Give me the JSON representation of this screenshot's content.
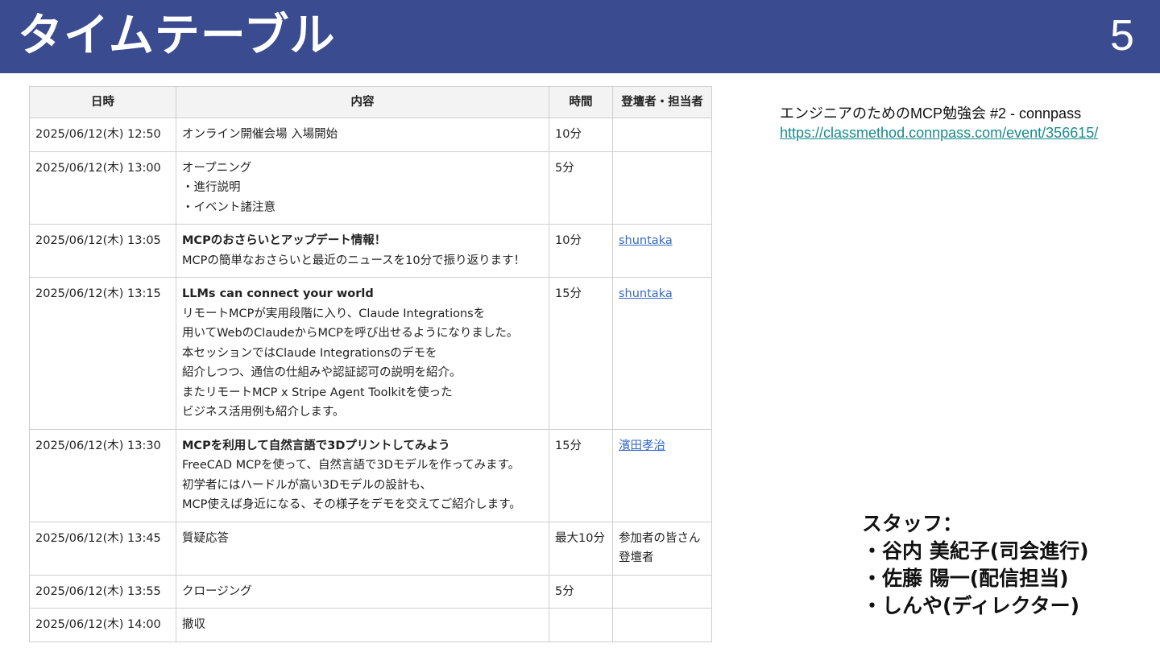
{
  "header": {
    "title": "タイムテーブル",
    "page_number": "5",
    "bg_color": "#3a4b90"
  },
  "table": {
    "headers": [
      "日時",
      "内容",
      "時間",
      "登壇者・担当者"
    ],
    "rows": [
      {
        "datetime": "2025/06/12(木) 12:50",
        "title": "",
        "lines": [
          "オンライン開催会場 入場開始"
        ],
        "duration": "10分",
        "person": ""
      },
      {
        "datetime": "2025/06/12(木) 13:00",
        "title": "",
        "lines": [
          "オープニング",
          "・進行説明",
          "・イベント諸注意"
        ],
        "duration": "5分",
        "person": ""
      },
      {
        "datetime": "2025/06/12(木) 13:05",
        "title": "MCPのおさらいとアップデート情報！",
        "lines": [
          "MCPの簡単なおさらいと最近のニュースを10分で振り返ります！"
        ],
        "duration": "10分",
        "person": "shuntaka"
      },
      {
        "datetime": "2025/06/12(木) 13:15",
        "title": "LLMs can connect your world",
        "lines": [
          "リモートMCPが実用段階に入り、Claude Integrationsを",
          "用いてWebのClaudeからMCPを呼び出せるようになりました。",
          "本セッションではClaude Integrationsのデモを",
          "紹介しつつ、通信の仕組みや認証認可の説明を紹介。",
          "またリモートMCP x Stripe Agent Toolkitを使った",
          "ビジネス活用例も紹介します。"
        ],
        "duration": "15分",
        "person": "shuntaka"
      },
      {
        "datetime": "2025/06/12(木) 13:30",
        "title": "MCPを利用して自然言語で3Dプリントしてみよう",
        "lines": [
          "FreeCAD MCPを使って、自然言語で3Dモデルを作ってみます。",
          "初学者にはハードルが高い3Dモデルの設計も、",
          "MCP使えば身近になる、その様子をデモを交えてご紹介します。"
        ],
        "duration": "15分",
        "person": "濱田孝治"
      },
      {
        "datetime": "2025/06/12(木) 13:45",
        "title": "",
        "lines": [
          "質疑応答"
        ],
        "duration": "最大10分",
        "person": "参加者の皆さん\n登壇者"
      },
      {
        "datetime": "2025/06/12(木) 13:55",
        "title": "",
        "lines": [
          "クロージング"
        ],
        "duration": "5分",
        "person": ""
      },
      {
        "datetime": "2025/06/12(木) 14:00",
        "title": "",
        "lines": [
          "撤収"
        ],
        "duration": "",
        "person": ""
      }
    ]
  },
  "event": {
    "title": "エンジニアのためのMCP勉強会 #2 - connpass",
    "url": "https://classmethod.connpass.com/event/356615/"
  },
  "staff": {
    "heading": "スタッフ：",
    "members": [
      "・谷内 美紀子(司会進行)",
      "・佐藤 陽一(配信担当)",
      "・しんや(ディレクター)"
    ]
  },
  "colors": {
    "link": "#3469c4",
    "url": "#1a8b8b",
    "header_cell": "#f3f3f3"
  }
}
